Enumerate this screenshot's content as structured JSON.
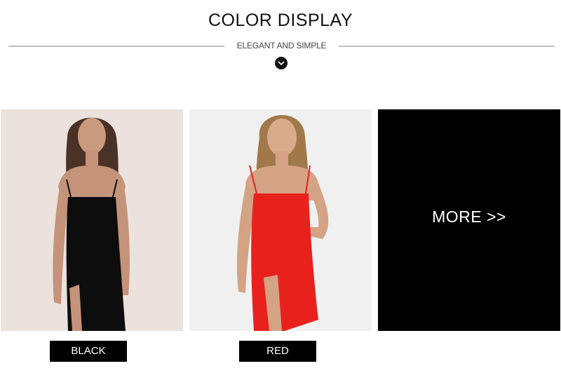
{
  "header": {
    "title": "COLOR DISPLAY",
    "subtitle": "ELEGANT AND SIMPLE"
  },
  "products": [
    {
      "label": "BLACK",
      "dress_color": "#0d0d0d"
    },
    {
      "label": "RED",
      "dress_color": "#e8211d"
    }
  ],
  "more": {
    "label": "MORE >>"
  },
  "colors": {
    "accent": "#000000",
    "text_on_dark": "#ffffff",
    "rule": "#bdbdbd"
  }
}
